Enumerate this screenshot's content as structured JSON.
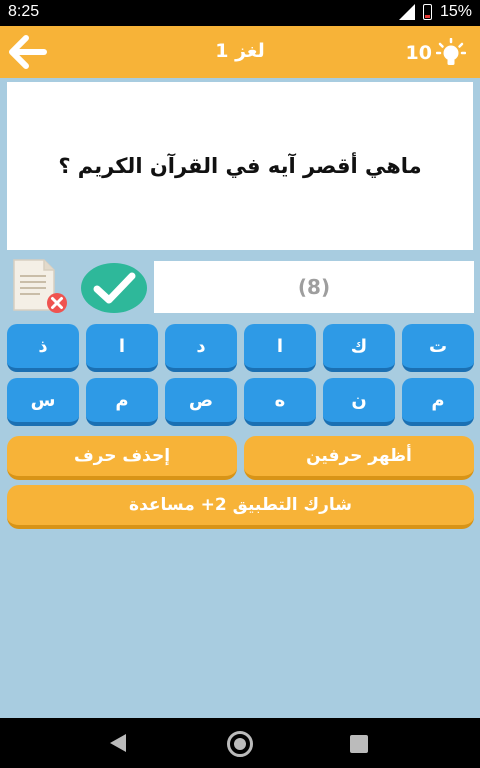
{
  "status": {
    "time": "8:25",
    "battery": "15%"
  },
  "appbar": {
    "title": "لغز 1",
    "hints_count": "10"
  },
  "question": {
    "text": "ماهي أقصر آيه في القرآن الكريم ؟"
  },
  "answer": {
    "placeholder": "(8)"
  },
  "letters_row1": [
    "ت",
    "ك",
    "ا",
    "د",
    "ا",
    "ذ"
  ],
  "letters_row2": [
    "م",
    "ن",
    "ه",
    "ص",
    "م",
    "س"
  ],
  "actions": {
    "reveal_two": "أظهر حرفين",
    "delete_letter": "إحذف حرف",
    "share": "شارك التطبيق 2+ مساعدة"
  },
  "colors": {
    "accent": "#f7b338",
    "key": "#2e9ae6",
    "background": "#a8cce0",
    "check": "#2eb89a"
  }
}
